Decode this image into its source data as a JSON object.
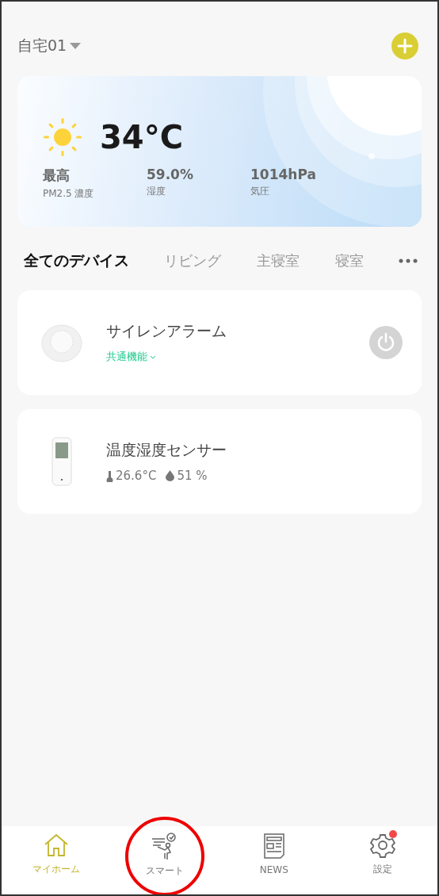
{
  "home": {
    "name": "自宅01"
  },
  "weather": {
    "temperature": "34°C",
    "stats": [
      {
        "value": "最高",
        "label": "PM2.5 濃度"
      },
      {
        "value": "59.0%",
        "label": "湿度"
      },
      {
        "value": "1014hPa",
        "label": "気圧"
      }
    ]
  },
  "rooms": [
    {
      "label": "全てのデバイス",
      "selected": true
    },
    {
      "label": "リビング",
      "selected": false
    },
    {
      "label": "主寝室",
      "selected": false
    },
    {
      "label": "寝室",
      "selected": false
    }
  ],
  "devices": [
    {
      "kind": "switch",
      "name": "サイレンアラーム",
      "link": "共通機能",
      "on": false
    },
    {
      "kind": "sensor",
      "name": "温度湿度センサー",
      "temperature": "26.6°C",
      "humidity": "51 %"
    }
  ],
  "nav": [
    {
      "label": "マイホーム",
      "selected": true,
      "highlighted": false,
      "badge": false
    },
    {
      "label": "スマート",
      "selected": false,
      "highlighted": true,
      "badge": false
    },
    {
      "label": "NEWS",
      "selected": false,
      "highlighted": false,
      "badge": false
    },
    {
      "label": "設定",
      "selected": false,
      "highlighted": false,
      "badge": true
    }
  ]
}
